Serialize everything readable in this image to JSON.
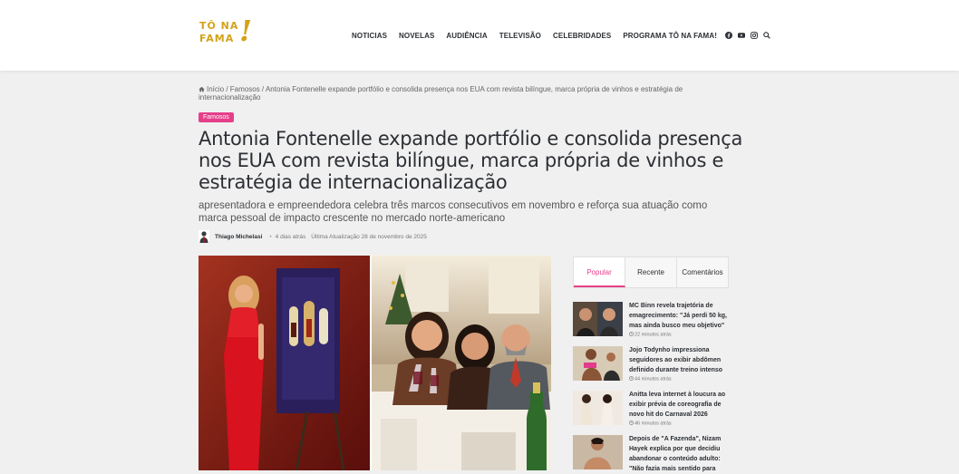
{
  "logo": {
    "line1": "TÔ NA",
    "line2": "FAMA",
    "mark": "!"
  },
  "nav": {
    "items": [
      "NOTICIAS",
      "NOVELAS",
      "AUDIÊNCIA",
      "TELEVISÃO",
      "CELEBRIDADES",
      "PROGRAMA TÔ NA FAMA!"
    ],
    "icons": [
      "facebook-icon",
      "youtube-icon",
      "instagram-icon",
      "search-icon"
    ]
  },
  "breadcrumb": {
    "home": "Início",
    "sep1": " / ",
    "section": "Famosos",
    "sep2": " / ",
    "current": "Antonia Fontenelle expande portfólio e consolida presença nos EUA com revista bilíngue, marca própria de vinhos e estratégia de internacionalização"
  },
  "article": {
    "category": "Famosos",
    "title": "Antonia Fontenelle expande portfólio e consolida presença nos EUA com revista bilíngue, marca própria de vinhos e estratégia de internacionalização",
    "subtitle": "apresentadora e empreendedora celebra três marcos consecutivos em novembro e reforça sua atuação como marca pessoal de impacto crescente no mercado norte-americano",
    "author": "Thiago Michelasi",
    "published": "4 dias atrás",
    "updated": "Última Atualização 28 de novembro de 2025"
  },
  "sidebar": {
    "tabs": [
      "Popular",
      "Recente",
      "Comentários"
    ],
    "active_tab": "Popular",
    "posts": [
      {
        "title": "MC Binn revela trajetória de emagrecimento: \"Já perdi 50 kg, mas ainda busco meu objetivo\"",
        "time": "22 minutos atrás"
      },
      {
        "title": "Jojo Todynho impressiona seguidores ao exibir abdômen definido durante treino intenso",
        "time": "44 minutos atrás"
      },
      {
        "title": "Anitta leva internet à loucura ao exibir prévia de coreografia de novo hit do Carnaval 2026",
        "time": "46 minutos atrás"
      },
      {
        "title": "Depois de \"A Fazenda\", Nizam Hayek explica por que decidiu abandonar o conteúdo adulto: \"Não fazia mais sentido para",
        "time": ""
      }
    ]
  },
  "colors": {
    "accent": "#e53f8a",
    "logo": "#d4a21a",
    "text": "#2c2f34"
  }
}
